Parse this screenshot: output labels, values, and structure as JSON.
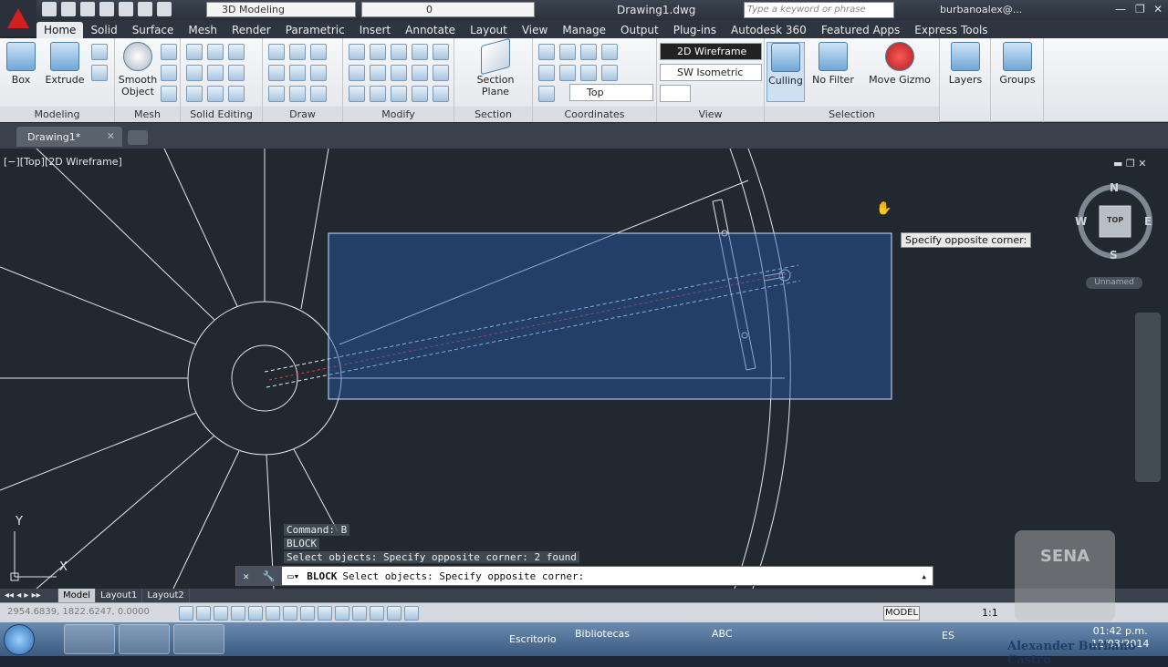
{
  "titlebar": {
    "workspace": "3D Modeling",
    "layer": "0",
    "doc_title": "Drawing1.dwg",
    "search_placeholder": "Type a keyword or phrase",
    "user": "burbanoalex@...",
    "minimize": "—",
    "restore": "❐",
    "close": "✕"
  },
  "ribbon_tabs": [
    "Home",
    "Solid",
    "Surface",
    "Mesh",
    "Render",
    "Parametric",
    "Insert",
    "Annotate",
    "Layout",
    "View",
    "Manage",
    "Output",
    "Plug-ins",
    "Autodesk 360",
    "Featured Apps",
    "Express Tools"
  ],
  "ribbon": {
    "box": "Box",
    "extrude": "Extrude",
    "smooth_object_1": "Smooth",
    "smooth_object_2": "Object",
    "section_plane_1": "Section",
    "section_plane_2": "Plane",
    "visual_style": "2D Wireframe",
    "view_preset": "SW Isometric",
    "named_view": "Top",
    "culling": "Culling",
    "no_filter": "No Filter",
    "move_gizmo": "Move Gizmo",
    "layers": "Layers",
    "groups": "Groups",
    "panels": {
      "modeling": "Modeling",
      "mesh": "Mesh",
      "solid_editing": "Solid Editing",
      "draw": "Draw",
      "modify": "Modify",
      "section": "Section",
      "coordinates": "Coordinates",
      "view": "View",
      "selection": "Selection"
    }
  },
  "doc_tab": "Drawing1*",
  "viewport": {
    "label": "[−][Top][2D Wireframe]",
    "tooltip": "Specify opposite corner:",
    "compass_n": "N",
    "compass_s": "S",
    "compass_e": "E",
    "compass_w": "W",
    "cube_face": "TOP",
    "ucs_name": "Unnamed",
    "ucs_y": "Y",
    "ucs_x": "X"
  },
  "command": {
    "history": [
      "Command: B",
      "BLOCK",
      "Select objects: Specify opposite corner: 2 found"
    ],
    "prompt_keyword": "BLOCK",
    "prompt_text": "Select objects: Specify opposite corner:"
  },
  "layout_tabs": [
    "Model",
    "Layout1",
    "Layout2"
  ],
  "status": {
    "coords": "2954.6839, 1822.6247, 0.0000",
    "model": "MODEL",
    "scale": "1:1"
  },
  "taskbar": {
    "desktop": "Escritorio",
    "libraries": "Bibliotecas",
    "abc": "ABC",
    "lang": "ES",
    "time": "01:42 p.m.",
    "date": "12/03/2014"
  },
  "watermark": {
    "author": "Alexander Burbano Castro",
    "sena": "SENA"
  }
}
